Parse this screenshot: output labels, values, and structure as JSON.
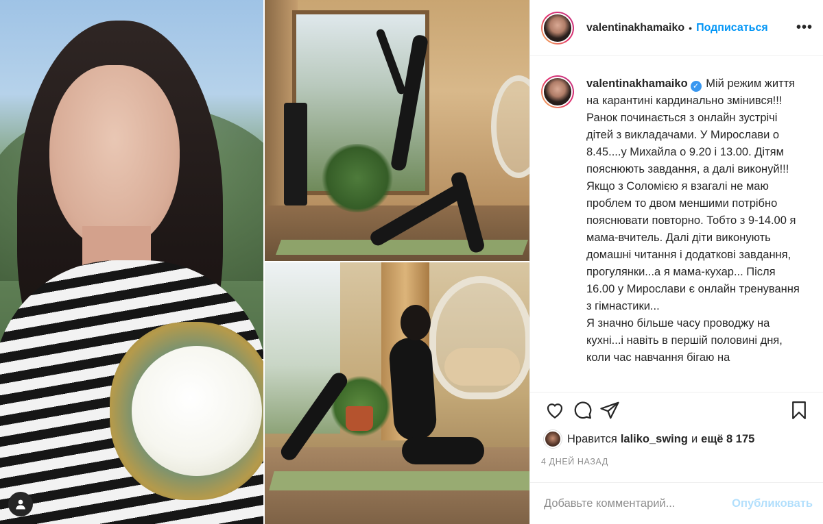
{
  "post": {
    "username": "valentinakhamaiko",
    "separator": "•",
    "follow_label": "Подписаться",
    "more_label": "•••",
    "verified_glyph": "✓",
    "caption_text": "Мій режим життя на карантині кардинально змінився!!! Ранок починається з онлайн зустрічі дітей з викладачами. У Мирослави о 8.45....у Михайла о 9.20 і 13.00. Дітям пояснюють завдання, а далі виконуй!!! Якщо з Соломією я взагалі не маю проблем то двом меншими потрібно пояснювати повторно. Тобто з 9-14.00 я мама-вчитель. Далі діти виконують домашні читання і додаткові завдання, прогулянки...а я мама-кухар... Після 16.00 у Мирослави є онлайн тренування з гімнастики...\nЯ значно більше часу проводжу на кухні...і навіть в першій половині дня, коли час навчання бігаю на"
  },
  "likes": {
    "prefix": "Нравится",
    "user": "laliko_swing",
    "middle": "и",
    "count_text": "ещё 8 175"
  },
  "timestamp": "4 ДНЕЙ НАЗАД",
  "comment": {
    "placeholder": "Добавьте комментарий...",
    "post_label": "Опубликовать"
  },
  "icons": {
    "like": "heart-icon",
    "comment": "comment-icon",
    "share": "share-icon",
    "save": "bookmark-icon",
    "user_tag": "user-tag-icon"
  },
  "colors": {
    "link_blue": "#0095f6",
    "post_disabled": "#b2dffc",
    "verified": "#3897f0",
    "muted_text": "#8e8e8e",
    "divider": "#efefef"
  }
}
